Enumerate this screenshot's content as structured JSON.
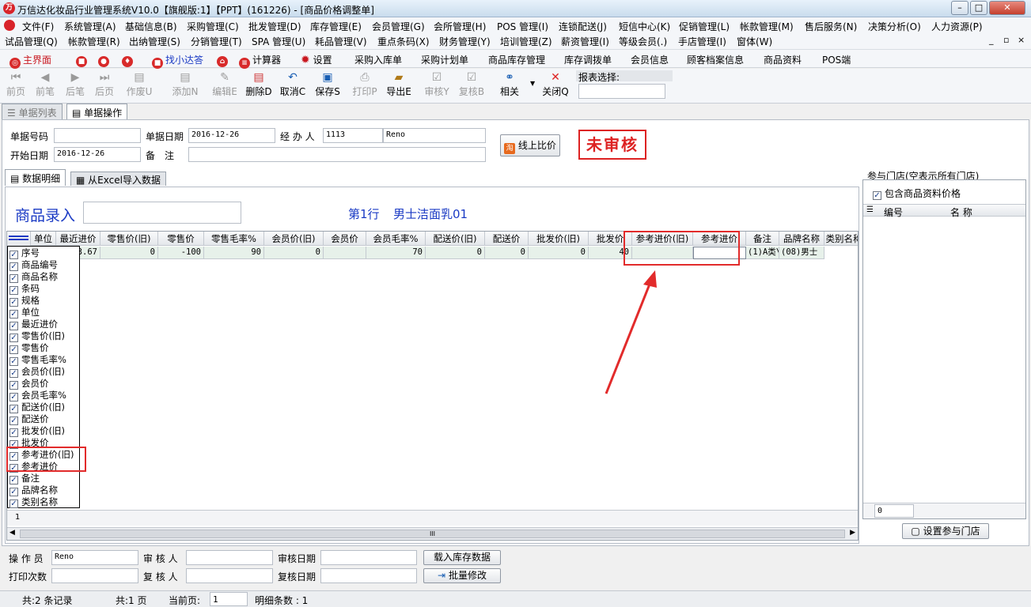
{
  "window": {
    "title": "万信达化妆品行业管理系统V10.0【旗舰版:1】【PPT】(161226) - [商品价格调整单]",
    "min": "–",
    "max": "□",
    "close": "✕"
  },
  "menu_row1": [
    "文件(F)",
    "系统管理(A)",
    "基础信息(B)",
    "采购管理(C)",
    "批发管理(D)",
    "库存管理(E)",
    "会员管理(G)",
    "会所管理(H)",
    "POS 管理(I)",
    "连锁配送(J)",
    "短信中心(K)",
    "促销管理(L)",
    "帐款管理(M)",
    "售后服务(N)",
    "决策分析(O)",
    "人力资源(P)"
  ],
  "menu_row2": [
    "试品管理(Q)",
    "帐款管理(R)",
    "出纳管理(S)",
    "分销管理(T)",
    "SPA 管理(U)",
    "耗品管理(V)",
    "重点条码(X)",
    "财务管理(Y)",
    "培训管理(Z)",
    "薪资管理(I)",
    "等级会员(.)",
    "手店管理(I)",
    "窗体(W)"
  ],
  "quick": {
    "home": "主界面",
    "find": "找小达答",
    "calc": "计算器",
    "settings": "设置",
    "items": [
      "采购入库单",
      "采购计划单",
      "商品库存管理",
      "库存调拨单",
      "会员信息",
      "顾客档案信息",
      "商品资料",
      "POS端"
    ]
  },
  "toolbar": {
    "first": "前页",
    "prev": "前笔",
    "next": "后笔",
    "last": "后页",
    "void": "作废U",
    "add": "添加N",
    "edit": "编辑E",
    "delete": "删除D",
    "cancel": "取消C",
    "save": "保存S",
    "print": "打印P",
    "export": "导出E",
    "audit": "审核Y",
    "reaudit": "复核B",
    "related": "相关",
    "close": "关闭Q",
    "report_label": "报表选择:"
  },
  "tabs": {
    "list": "单据列表",
    "operate": "单据操作"
  },
  "form": {
    "doc_no_label": "单据号码",
    "doc_no": "",
    "doc_date_label": "单据日期",
    "doc_date": "2016-12-26",
    "handler_label": "经 办 人",
    "handler_code": "1113",
    "handler_name": "Reno",
    "start_date_label": "开始日期",
    "start_date": "2016-12-26",
    "remark_label": "备　注",
    "remark": "",
    "compare_btn": "线上比价",
    "status": "未审核"
  },
  "subtabs": {
    "detail": "数据明细",
    "excel": "从Excel导入数据"
  },
  "entry": {
    "label": "商品录入",
    "value": "",
    "row_info": "第1行",
    "product": "男士洁面乳01"
  },
  "grid": {
    "columns": [
      "单位",
      "最近进价",
      "零售价(旧)",
      "零售价",
      "零售毛率%",
      "会员价(旧)",
      "会员价",
      "会员毛率%",
      "配送价(旧)",
      "配送价",
      "批发价(旧)",
      "批发价",
      "参考进价(旧)",
      "参考进价",
      "备注",
      "品牌名称",
      "类别名称"
    ],
    "row": [
      "40",
      "143.67",
      "0",
      "-100",
      "90",
      "0",
      "",
      "70",
      "0",
      "0",
      "0",
      "40",
      "",
      "",
      "(1)A类\\(",
      "(08)男士"
    ],
    "footer_row": "1",
    "scroll_mark": "III"
  },
  "column_picker": [
    "序号",
    "商品编号",
    "商品名称",
    "条码",
    "规格",
    "单位",
    "最近进价",
    "零售价(旧)",
    "零售价",
    "零售毛率%",
    "会员价(旧)",
    "会员价",
    "会员毛率%",
    "配送价(旧)",
    "配送价",
    "批发价(旧)",
    "批发价",
    "参考进价(旧)",
    "参考进价",
    "备注",
    "品牌名称",
    "类别名称"
  ],
  "right_panel": {
    "title": "参与门店(空表示所有门店)",
    "include_label": "包含商品资料价格",
    "col_no": "编号",
    "col_name": "名 称",
    "count": "0",
    "set_btn": "设置参与门店"
  },
  "bottom_form": {
    "operator_label": "操 作 员",
    "operator": "Reno",
    "auditor_label": "审 核 人",
    "auditor": "",
    "audit_date_label": "审核日期",
    "audit_date": "",
    "load_btn": "载入库存数据",
    "print_count_label": "打印次数",
    "print_count": "",
    "reauditor_label": "复 核 人",
    "reauditor": "",
    "reaudit_date_label": "复核日期",
    "reaudit_date": "",
    "batch_btn": "批量修改"
  },
  "status": {
    "records": "共:2 条记录",
    "pages": "共:1 页",
    "current_label": "当前页:",
    "current": "1",
    "detail_count": "明细条数 : 1"
  },
  "colors": {
    "accent_red": "#e22b2b",
    "link_blue": "#1a3ac4",
    "row_green": "#e7f1ea"
  }
}
